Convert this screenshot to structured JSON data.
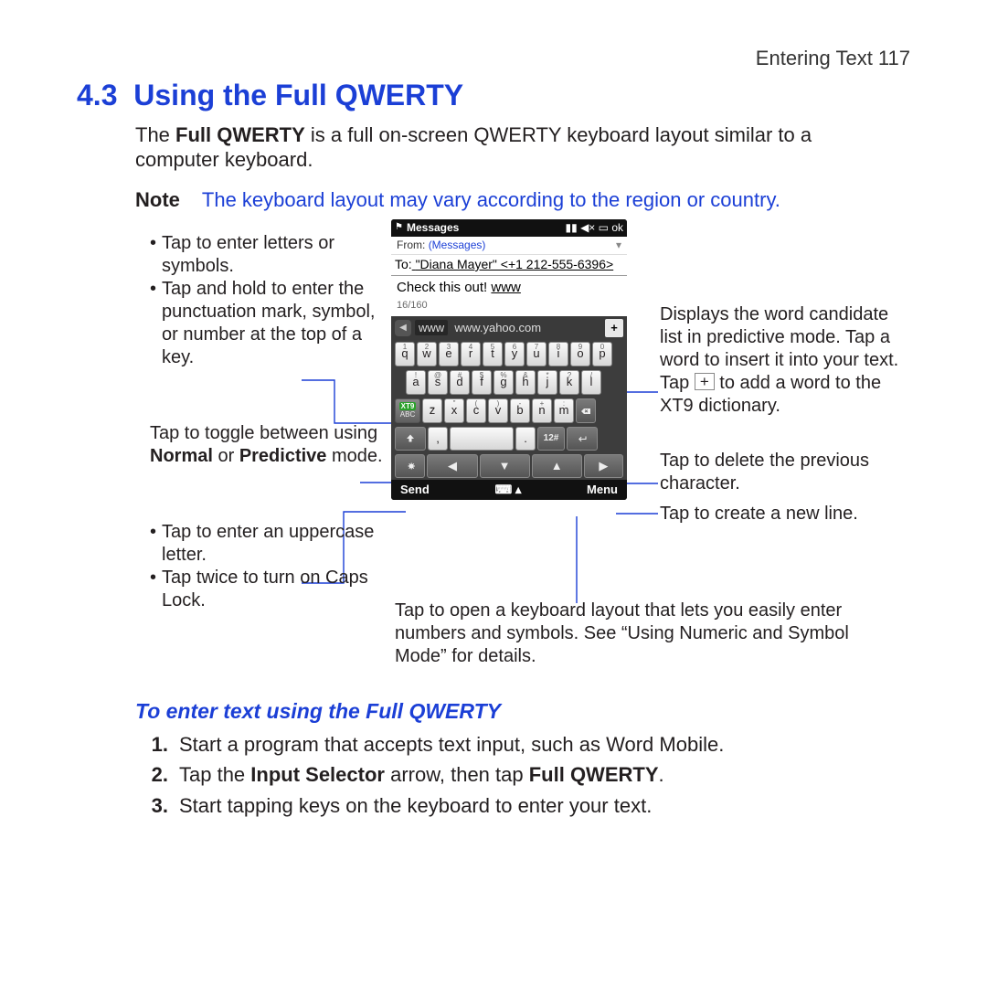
{
  "runningHead": "Entering Text  117",
  "sectionNumber": "4.3",
  "sectionTitle": "Using the Full QWERTY",
  "intro_pre": "The ",
  "intro_boldTerm": "Full QWERTY",
  "intro_post": " is a full on-screen QWERTY keyboard layout similar to a computer keyboard.",
  "noteLabel": "Note",
  "noteText": "The keyboard layout may vary according to the region or country.",
  "phone": {
    "appTitle": "Messages",
    "statusIcons": "▮▮  ◀×  ▭  ok",
    "fromLabel": "From:",
    "fromSource": "(Messages)",
    "toLabel": "To:",
    "toValue": "\"Diana Mayer\" <+1 212-555-6396>",
    "bodyPrefix": "Check this out! ",
    "bodyLink": "www",
    "counter": "16/160",
    "suggestSelected": "www",
    "suggestRest": "www.yahoo.com",
    "plus": "+",
    "softLeft": "Send",
    "softRight": "Menu",
    "row1": [
      {
        "s": "1",
        "l": "q"
      },
      {
        "s": "2",
        "l": "w"
      },
      {
        "s": "3",
        "l": "e"
      },
      {
        "s": "4",
        "l": "r"
      },
      {
        "s": "5",
        "l": "t"
      },
      {
        "s": "6",
        "l": "y"
      },
      {
        "s": "7",
        "l": "u"
      },
      {
        "s": "8",
        "l": "i"
      },
      {
        "s": "9",
        "l": "o"
      },
      {
        "s": "0",
        "l": "p"
      }
    ],
    "row2": [
      {
        "s": "!",
        "l": "a"
      },
      {
        "s": "@",
        "l": "s"
      },
      {
        "s": "#",
        "l": "d"
      },
      {
        "s": "$",
        "l": "f"
      },
      {
        "s": "%",
        "l": "g"
      },
      {
        "s": "&",
        "l": "h"
      },
      {
        "s": "*",
        "l": "j"
      },
      {
        "s": "?",
        "l": "k"
      },
      {
        "s": "/",
        "l": "l"
      }
    ],
    "row3": [
      {
        "s": "_",
        "l": "z"
      },
      {
        "s": "\"",
        "l": "x"
      },
      {
        "s": "(",
        "l": "c"
      },
      {
        "s": ")",
        "l": "v"
      },
      {
        "s": "-",
        "l": "b"
      },
      {
        "s": "+",
        "l": "n"
      },
      {
        "s": ":",
        "l": "m"
      }
    ],
    "numKeyLabel": "12#"
  },
  "callouts": {
    "letters_1": "Tap to enter letters or symbols.",
    "letters_2": "Tap and hold to enter the punctuation mark, symbol, or number at the top of a key.",
    "toggle_pre": "Tap to toggle between using ",
    "toggle_b1": "Normal",
    "toggle_mid": " or ",
    "toggle_b2": "Predictive",
    "toggle_post": " mode.",
    "shift_1": "Tap to enter an uppercase letter.",
    "shift_2": "Tap twice to turn on Caps Lock.",
    "candidate_pre": "Displays the word candidate list in predictive mode. Tap a word to insert it into your text. Tap ",
    "candidate_plus": "+",
    "candidate_post": " to add a word to the XT9 dictionary.",
    "delete": "Tap to delete the previous character.",
    "enter": "Tap to create a new line.",
    "numsym": "Tap to open a keyboard layout that lets you easily enter numbers and symbols. See “Using Numeric and Symbol Mode” for details."
  },
  "subhead": "To enter text using the Full QWERTY",
  "steps": {
    "s1_num": "1.",
    "s1": "Start a program that accepts text input, such as Word Mobile.",
    "s2_num": "2.",
    "s2_pre": "Tap the ",
    "s2_b1": "Input Selector",
    "s2_mid": " arrow, then tap ",
    "s2_b2": "Full QWERTY",
    "s2_post": ".",
    "s3_num": "3.",
    "s3": "Start tapping keys on the keyboard to enter your text."
  }
}
